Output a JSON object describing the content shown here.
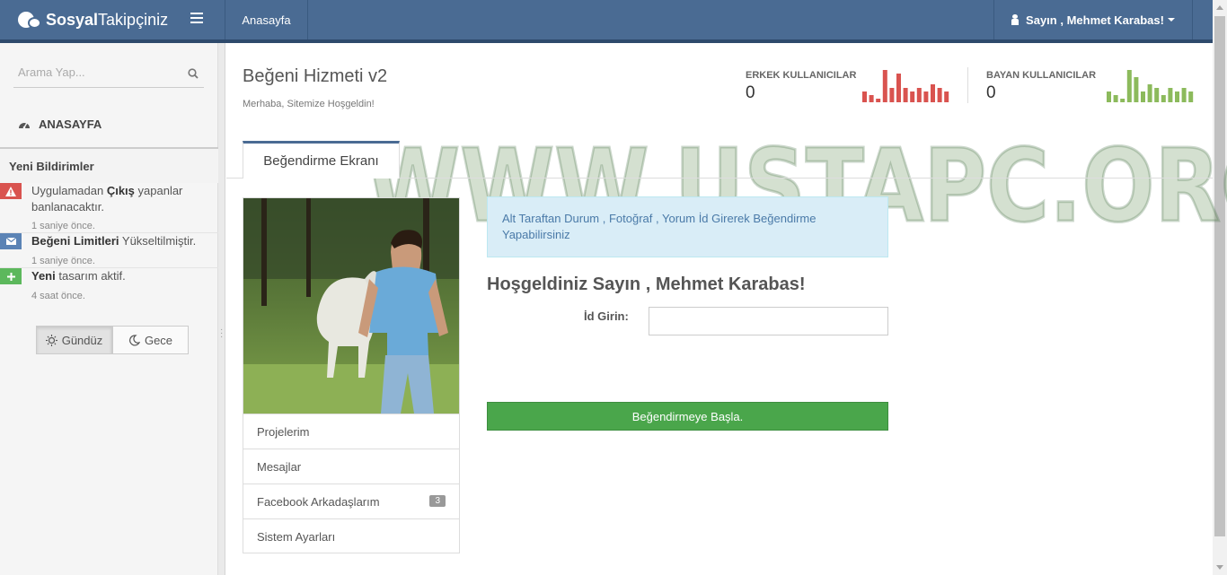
{
  "navbar": {
    "brand_bold": "Sosyal",
    "brand_light": "Takipçiniz",
    "menu_icon": "hamburger-icon",
    "home_link": "Anasayfa",
    "user_label": "Sayın , Mehmet Karabas!",
    "user_icon": "user-icon",
    "brand_color": "#4a6b93"
  },
  "sidebar": {
    "search_placeholder": "Arama Yap...",
    "home_item": "ANASAYFA",
    "notifications_header": "Yeni Bildirimler",
    "notifications": [
      {
        "icon": "warning-icon",
        "color": "#d9534f",
        "bold": "Çıkış",
        "prefix": "Uygulamadan ",
        "suffix": " yapanlar banlanacaktır.",
        "time": "1 saniye önce."
      },
      {
        "icon": "envelope-icon",
        "color": "#5b83b5",
        "bold": "Beğeni Limitleri",
        "prefix": "",
        "suffix": " Yükseltilmiştir.",
        "time": "1 saniye önce."
      },
      {
        "icon": "plus-icon",
        "color": "#5cb85c",
        "bold": "Yeni",
        "prefix": "",
        "suffix": " tasarım aktif.",
        "time": "4 saat önce."
      }
    ],
    "mode_day": "Gündüz",
    "mode_night": "Gece"
  },
  "header": {
    "title": "Beğeni Hizmeti v2",
    "subtitle": "Merhaba, Sitemize Hoşgeldin!",
    "stats": [
      {
        "label": "ERKEK KULLANICILAR",
        "value": "0",
        "color": "#d9534f",
        "bars": [
          3,
          2,
          1,
          9,
          4,
          8,
          4,
          3,
          4,
          3,
          5,
          4,
          3
        ]
      },
      {
        "label": "BAYAN KULLANICILAR",
        "value": "0",
        "color": "#8cba5c",
        "bars": [
          3,
          2,
          1,
          9,
          7,
          3,
          5,
          4,
          2,
          4,
          3,
          4,
          3
        ]
      }
    ]
  },
  "watermark": "WWW.USTAPC.ORG",
  "tab": "Beğendirme Ekranı",
  "profile_menu": [
    {
      "label": "Projelerim",
      "badge": ""
    },
    {
      "label": "Mesajlar",
      "badge": ""
    },
    {
      "label": "Facebook Arkadaşlarım",
      "badge": "3"
    },
    {
      "label": "Sistem Ayarları",
      "badge": ""
    }
  ],
  "form": {
    "info": "Alt Taraftan Durum , Fotoğraf , Yorum İd Girerek Beğendirme Yapabilirsiniz",
    "welcome": "Hoşgeldiniz Sayın , Mehmet Karabas!",
    "id_label": "İd Girin:",
    "id_value": "",
    "submit": "Beğendirmeye Başla."
  }
}
